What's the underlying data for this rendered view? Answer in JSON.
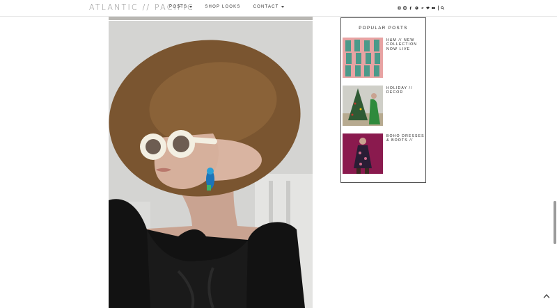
{
  "header": {
    "logo": "ATLANTIC // PACIFIC",
    "nav": [
      {
        "label": "POSTS",
        "dropdown": true
      },
      {
        "label": "SHOP LOOKS",
        "dropdown": false
      },
      {
        "label": "CONTACT",
        "dropdown": true
      }
    ],
    "social_icons": [
      "bloglovin-icon",
      "instagram-icon",
      "facebook-icon",
      "pinterest-icon",
      "twitter-icon",
      "heart-icon",
      "youtube-icon",
      "search-icon"
    ]
  },
  "sidebar": {
    "popular_title": "POPULAR POSTS",
    "posts": [
      {
        "title": "H&M // NEW COLLECTION NOW LIVE"
      },
      {
        "title": "HOLIDAY // DECOR"
      },
      {
        "title": "BOHO DRESSES & BOOTS //"
      }
    ]
  },
  "colors": {
    "accent_text": "#222222",
    "hat_straw": "#7a5530",
    "sunglasses": "#f3efe2",
    "dress": "#111111",
    "thumb1_bg": "#e8a3a3",
    "thumb3_bg": "#8a1a4e"
  }
}
